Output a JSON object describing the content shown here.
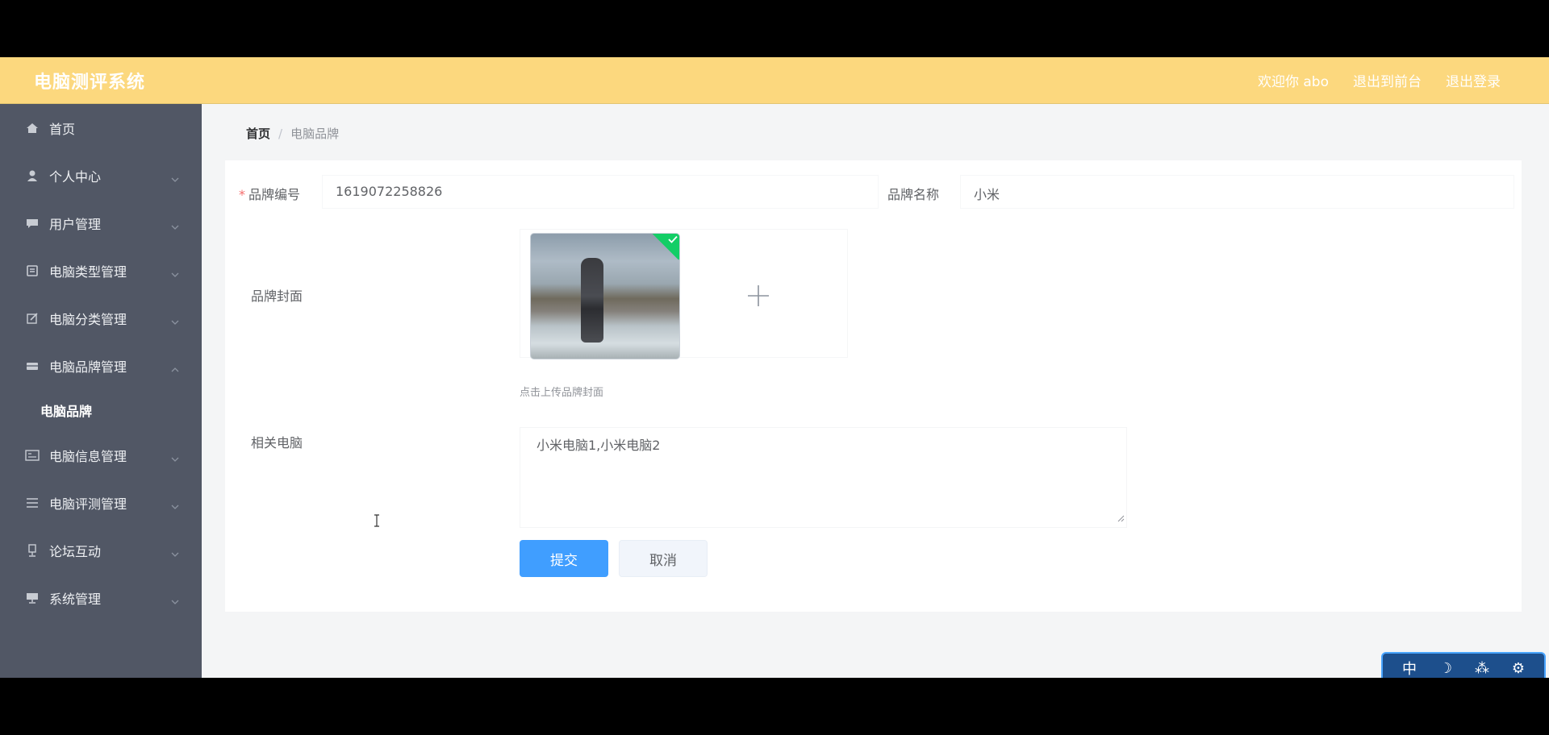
{
  "header": {
    "brand": "电脑测评系统",
    "links": [
      "欢迎你 abo",
      "退出到前台",
      "退出登录"
    ]
  },
  "sidebar": {
    "items": [
      {
        "label": "首页",
        "icon": "home-icon",
        "chevron": false
      },
      {
        "label": "个人中心",
        "icon": "user-icon",
        "chevron": true
      },
      {
        "label": "用户管理",
        "icon": "chat-icon",
        "chevron": true
      },
      {
        "label": "电脑类型管理",
        "icon": "document-icon",
        "chevron": true
      },
      {
        "label": "电脑分类管理",
        "icon": "edit-icon",
        "chevron": true
      },
      {
        "label": "电脑品牌管理",
        "icon": "tray-icon",
        "chevron": true
      }
    ],
    "sub_item": "电脑品牌",
    "items_after": [
      {
        "label": "电脑信息管理",
        "icon": "card-icon",
        "chevron": true
      },
      {
        "label": "电脑评测管理",
        "icon": "menu-icon",
        "chevron": true
      },
      {
        "label": "论坛互动",
        "icon": "cup-icon",
        "chevron": true
      },
      {
        "label": "系统管理",
        "icon": "monitor-icon",
        "chevron": true
      }
    ]
  },
  "breadcrumb": {
    "home": "首页",
    "separator": "/",
    "current": "电脑品牌"
  },
  "form": {
    "brand_code_label": "品牌编号",
    "brand_code_value": "1619072258826",
    "brand_name_label": "品牌名称",
    "brand_name_value": "小米",
    "cover_label": "品牌封面",
    "upload_tip": "点击上传品牌封面",
    "related_label": "相关电脑",
    "related_value": "小米电脑1,小米电脑2",
    "submit_label": "提交",
    "cancel_label": "取消"
  },
  "widget": {
    "buttons": [
      "中",
      "☽",
      "⁂",
      "⚙"
    ]
  }
}
